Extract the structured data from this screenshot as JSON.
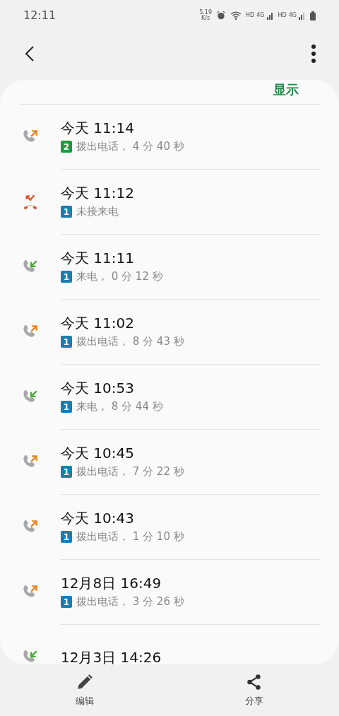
{
  "status_bar": {
    "time": "12:11",
    "speed": "5.19",
    "speed_unit": "K/s",
    "sim_labels": [
      {
        "hd": "HD",
        "net": "4G"
      },
      {
        "hd": "HD",
        "net": "4G"
      }
    ]
  },
  "header_action": "显示",
  "calls": [
    {
      "kind": "outgoing",
      "title": "今天 11:14",
      "sim": "2",
      "color": "#1e9a3a",
      "detail": "拨出电话， 4 分 40 秒"
    },
    {
      "kind": "missed",
      "title": "今天 11:12",
      "sim": "1",
      "color": "#1b7db0",
      "detail": "未接来电"
    },
    {
      "kind": "incoming",
      "title": "今天 11:11",
      "sim": "1",
      "color": "#1b7db0",
      "detail": "来电， 0 分 12 秒"
    },
    {
      "kind": "outgoing",
      "title": "今天 11:02",
      "sim": "1",
      "color": "#1b7db0",
      "detail": "拨出电话， 8 分 43 秒"
    },
    {
      "kind": "incoming",
      "title": "今天 10:53",
      "sim": "1",
      "color": "#1b7db0",
      "detail": "来电， 8 分 44 秒"
    },
    {
      "kind": "outgoing",
      "title": "今天 10:45",
      "sim": "1",
      "color": "#1b7db0",
      "detail": "拨出电话， 7 分 22 秒"
    },
    {
      "kind": "outgoing",
      "title": "今天 10:43",
      "sim": "1",
      "color": "#1b7db0",
      "detail": "拨出电话， 1 分 10 秒"
    },
    {
      "kind": "outgoing",
      "title": "12月8日 16:49",
      "sim": "1",
      "color": "#1b7db0",
      "detail": "拨出电话， 3 分 26 秒"
    },
    {
      "kind": "incoming",
      "title": "12月3日 14:26"
    }
  ],
  "bottom_actions": [
    {
      "kind": "edit",
      "label": "编辑"
    },
    {
      "kind": "share",
      "label": "分享"
    }
  ]
}
